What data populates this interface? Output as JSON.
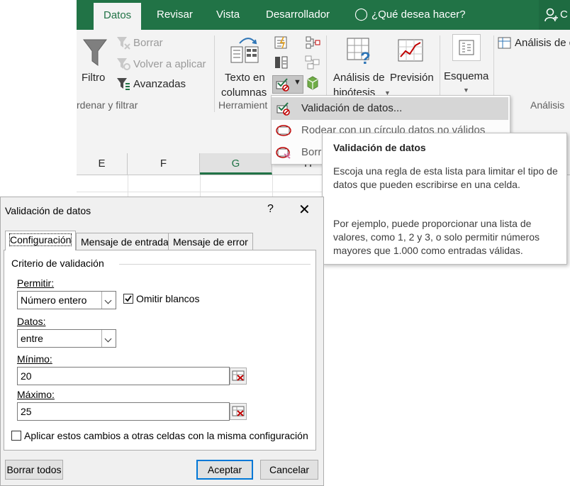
{
  "ribbon": {
    "tabs": [
      {
        "label": "Datos",
        "active": true
      },
      {
        "label": "Revisar"
      },
      {
        "label": "Vista"
      },
      {
        "label": "Desarrollador"
      },
      {
        "label": "¿Qué desea hacer?"
      }
    ],
    "account_label": "C",
    "sort_filter": {
      "filtro": "Filtro",
      "borrar": "Borrar",
      "volver_aplicar": "Volver a aplicar",
      "avanzadas": "Avanzadas",
      "group_label": "rdenar y filtrar"
    },
    "data_tools": {
      "texto_en": "Texto en",
      "columnas": "columnas",
      "group_label": "Herramient"
    },
    "forecast": {
      "analisis_de": "Análisis de",
      "hipotesis": "hipótesis",
      "prevision": "Previsión",
      "group_label": ""
    },
    "outline": {
      "esquema": "Esquema"
    },
    "analysis": {
      "analisis_de_datos": "Análisis de d",
      "group_label": "Análisis"
    }
  },
  "sheet": {
    "columns": [
      "E",
      "F",
      "G",
      "H"
    ],
    "selected_column": "G"
  },
  "menu": {
    "items": [
      {
        "label": "Validación de datos...",
        "highlighted": true
      },
      {
        "label": "Rodear con un círculo datos no válidos"
      },
      {
        "label": "Borr"
      }
    ]
  },
  "tooltip": {
    "title": "Validación de datos",
    "paragraph1": "Escoja una regla de esta lista para limitar el tipo de datos que pueden escribirse en una celda.",
    "paragraph2": "Por ejemplo, puede proporcionar una lista de valores, como 1, 2 y 3, o solo permitir números mayores que 1.000 como entradas válidas."
  },
  "dialog": {
    "title": "Validación de datos",
    "help": "?",
    "close": "✕",
    "tabs": [
      "Configuración",
      "Mensaje de entrada",
      "Mensaje de error"
    ],
    "section_label": "Criterio de validación",
    "permitir_label": "Permitir:",
    "permitir_value": "Número entero",
    "omitir_blancos_label": "Omitir blancos",
    "omitir_blancos_checked": true,
    "datos_label": "Datos:",
    "datos_value": "entre",
    "minimo_label": "Mínimo:",
    "minimo_value": "20",
    "maximo_label": "Máximo:",
    "maximo_value": "25",
    "apply_all_label": "Aplicar estos cambios a otras celdas con la misma configuración",
    "apply_all_checked": false,
    "borrar_todos": "Borrar todos",
    "aceptar": "Aceptar",
    "cancelar": "Cancelar"
  },
  "colors": {
    "excel_green": "#217346",
    "ribbon_bg": "#f3f3f3",
    "dialog_bg": "#f0f0f0",
    "focus_blue": "#0078d7"
  }
}
